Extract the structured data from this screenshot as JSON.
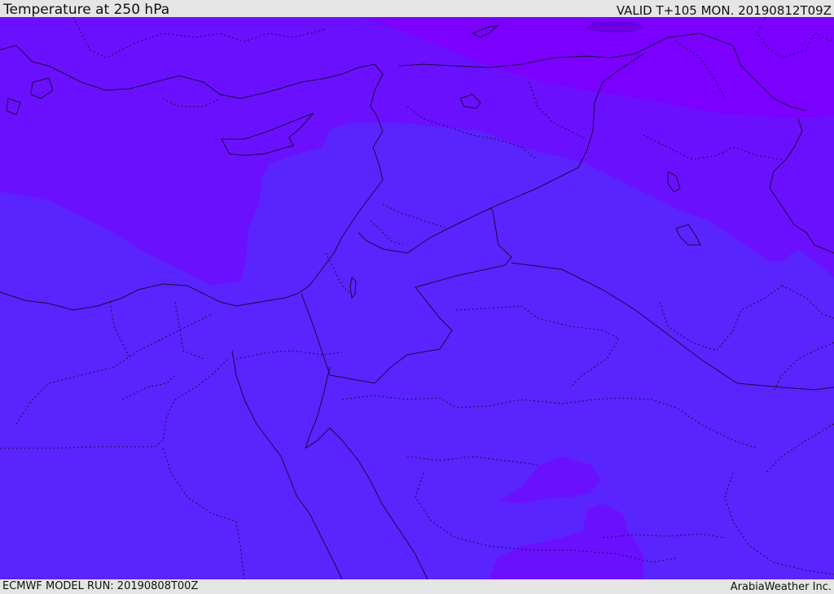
{
  "header": {
    "title": "Temperature at 250 hPa",
    "valid": "VALID T+105 MON. 20190812T09Z"
  },
  "footer": {
    "model_run": "ECMWF MODEL RUN: 20190808T00Z",
    "credit": "ArabiaWeather Inc."
  },
  "map": {
    "colors": {
      "coldest_band": "#7b00ff",
      "cold_band": "#6b10ff",
      "base_band": "#5a24ff",
      "coastline": "#1a0a40",
      "border": "#1a0a40"
    }
  }
}
